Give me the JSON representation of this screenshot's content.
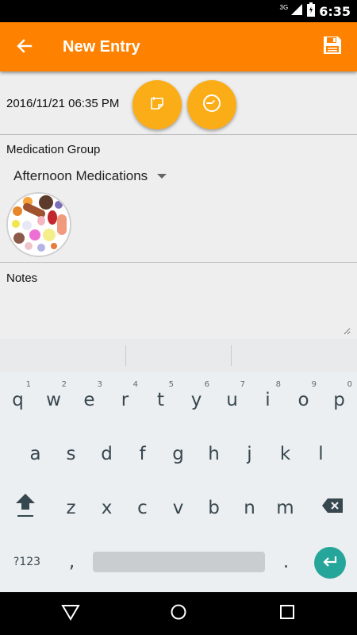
{
  "status_bar": {
    "time": "6:35",
    "network": "3G",
    "icons": [
      "signal-icon",
      "battery-icon"
    ]
  },
  "app_bar": {
    "title": "New Entry",
    "back_icon": "arrow-left-icon",
    "save_icon": "floppy-disk-icon",
    "background": "#FF8100"
  },
  "entry": {
    "datetime": "2016/11/21 06:35 PM",
    "date_button_icon": "calendar-icon",
    "time_button_icon": "clock-icon",
    "accent": "#FBAD17"
  },
  "medication": {
    "label": "Medication Group",
    "selected": "Afternoon Medications",
    "image_icon": "pills-icon"
  },
  "notes": {
    "label": "Notes",
    "value": "",
    "placeholder": ""
  },
  "keyboard": {
    "rows": [
      [
        {
          "key": "q",
          "hint": "1"
        },
        {
          "key": "w",
          "hint": "2"
        },
        {
          "key": "e",
          "hint": "3"
        },
        {
          "key": "r",
          "hint": "4"
        },
        {
          "key": "t",
          "hint": "5"
        },
        {
          "key": "y",
          "hint": "6"
        },
        {
          "key": "u",
          "hint": "7"
        },
        {
          "key": "i",
          "hint": "8"
        },
        {
          "key": "o",
          "hint": "9"
        },
        {
          "key": "p",
          "hint": "0"
        }
      ],
      [
        {
          "key": "a"
        },
        {
          "key": "s"
        },
        {
          "key": "d"
        },
        {
          "key": "f"
        },
        {
          "key": "g"
        },
        {
          "key": "h"
        },
        {
          "key": "j"
        },
        {
          "key": "k"
        },
        {
          "key": "l"
        }
      ],
      [
        {
          "key": "z"
        },
        {
          "key": "x"
        },
        {
          "key": "c"
        },
        {
          "key": "v"
        },
        {
          "key": "b"
        },
        {
          "key": "n"
        },
        {
          "key": "m"
        }
      ]
    ],
    "symbols_label": "?123",
    "comma": ",",
    "period": ".",
    "shift_icon": "shift-icon",
    "backspace_icon": "backspace-icon",
    "enter_icon": "enter-icon"
  },
  "nav_bar": {
    "back_icon": "nav-back-icon",
    "home_icon": "nav-home-icon",
    "recents_icon": "nav-recents-icon"
  }
}
